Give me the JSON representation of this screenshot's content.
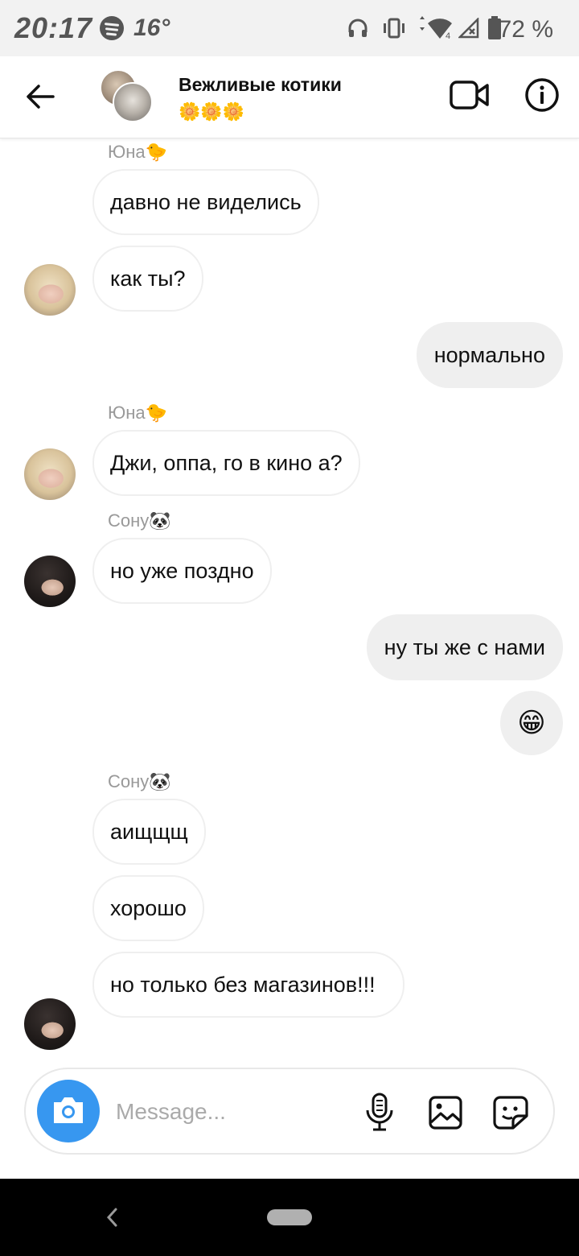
{
  "status_bar": {
    "time": "20:17",
    "temperature": "16°",
    "battery_text": "72 %",
    "network_label": "4"
  },
  "header": {
    "title": "Вежливые котики",
    "subtitle": "🌼🌼🌼"
  },
  "messages": [
    {
      "sender": "Юна🐤",
      "text": "давно не виделись"
    },
    {
      "text": "как ты?"
    },
    {
      "text": "нормально"
    },
    {
      "sender": "Юна🐤",
      "text": "Джи, оппа, го в кино а?"
    },
    {
      "sender": "Сону🐼",
      "text": "но уже поздно"
    },
    {
      "text": "ну ты же с нами"
    },
    {
      "text": "😁"
    },
    {
      "sender": "Сону🐼",
      "text": "аищщщ"
    },
    {
      "text": "хорошо"
    },
    {
      "text": "но только без магазинов!!!"
    }
  ],
  "composer": {
    "placeholder": "Message..."
  },
  "colors": {
    "accent": "#3797f0",
    "incoming_bubble_border": "#efefef",
    "outgoing_bubble": "#efefef"
  },
  "icons": [
    "back-arrow-icon",
    "video-call-icon",
    "info-icon",
    "camera-icon",
    "microphone-icon",
    "gallery-icon",
    "sticker-icon",
    "spotify-icon",
    "headphones-icon",
    "vibrate-icon",
    "wifi-icon",
    "signal-icon",
    "battery-icon"
  ]
}
